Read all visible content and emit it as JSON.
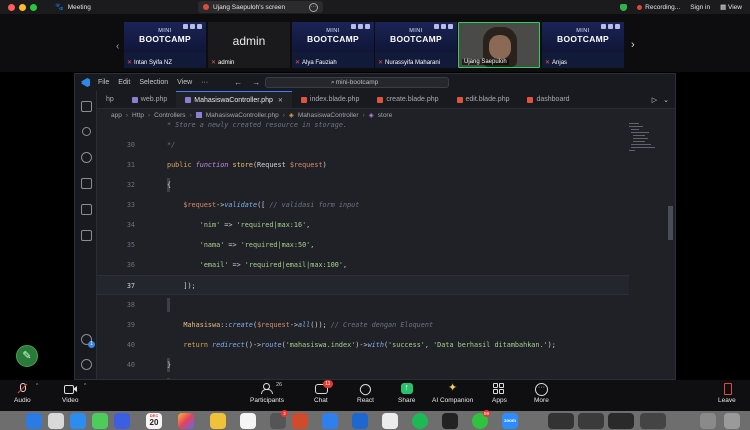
{
  "zoom": {
    "app_name": "Meeting",
    "share_title": "Ujang Saepuloh's screen",
    "recording_label": "Recording...",
    "signin_label": "Sign in",
    "view_label": "View"
  },
  "participants": [
    {
      "name": "Intan Syifa NZ",
      "kind": "banner",
      "line1": "MINI",
      "line2": "BOOTCAMP"
    },
    {
      "name": "admin",
      "kind": "admin",
      "display": "admin"
    },
    {
      "name": "Alya Fauziah",
      "kind": "banner",
      "line1": "MINI",
      "line2": "BOOTCAMP"
    },
    {
      "name": "Nurassyifa Maharani",
      "kind": "banner",
      "line1": "MINI",
      "line2": "BOOTCAMP"
    },
    {
      "name": "Ujang Saepuloh",
      "kind": "camera"
    },
    {
      "name": "Anjas",
      "kind": "banner",
      "line1": "MINI",
      "line2": "BOOTCAMP"
    }
  ],
  "vscode": {
    "menu": [
      "File",
      "Edit",
      "Selection",
      "View",
      "···"
    ],
    "command_center": "mini-bootcamp",
    "tabs": [
      {
        "label": "hp",
        "icon": "php",
        "active": false
      },
      {
        "label": "web.php",
        "icon": "php",
        "active": false
      },
      {
        "label": "MahasiswaController.php",
        "icon": "php",
        "active": true
      },
      {
        "label": "index.blade.php",
        "icon": "blade",
        "active": false
      },
      {
        "label": "create.blade.php",
        "icon": "blade",
        "active": false
      },
      {
        "label": "edit.blade.php",
        "icon": "blade",
        "active": false
      },
      {
        "label": "dashboard",
        "icon": "blade",
        "active": false
      }
    ],
    "breadcrumb": [
      "app",
      "Http",
      "Controllers",
      "MahasiswaController.php",
      "MahasiswaController",
      "store"
    ],
    "activity_badge": "1"
  },
  "code_lines": [
    {
      "n": "",
      "segs": [
        [
          "c-com",
          "* Store a newly created resource in storage."
        ]
      ]
    },
    {
      "n": "30",
      "segs": [
        [
          "c-com",
          "*/"
        ]
      ]
    },
    {
      "n": "31",
      "segs": [
        [
          "c-kw",
          "public "
        ],
        [
          "c-kw2",
          "function "
        ],
        [
          "c-fn",
          "store"
        ],
        [
          "c-txt",
          "(Request "
        ],
        [
          "c-var",
          "$request"
        ],
        [
          "c-txt",
          ")"
        ]
      ]
    },
    {
      "n": "32",
      "segs": [
        [
          "c-txt",
          "{"
        ]
      ]
    },
    {
      "n": "33",
      "segs": [
        [
          "c-txt",
          "    "
        ],
        [
          "c-var",
          "$request"
        ],
        [
          "c-txt",
          "->"
        ],
        [
          "c-mth",
          "validate"
        ],
        [
          "c-txt",
          "([ "
        ],
        [
          "c-com",
          "// validasi form input"
        ]
      ]
    },
    {
      "n": "34",
      "segs": [
        [
          "c-txt",
          "        "
        ],
        [
          "c-str",
          "'nim'"
        ],
        [
          "c-txt",
          " => "
        ],
        [
          "c-str",
          "'required|max:16'"
        ],
        [
          "c-txt",
          ","
        ]
      ]
    },
    {
      "n": "35",
      "segs": [
        [
          "c-txt",
          "        "
        ],
        [
          "c-str",
          "'nama'"
        ],
        [
          "c-txt",
          " => "
        ],
        [
          "c-str",
          "'required|max:50'"
        ],
        [
          "c-txt",
          ","
        ]
      ]
    },
    {
      "n": "36",
      "segs": [
        [
          "c-txt",
          "        "
        ],
        [
          "c-str",
          "'email'"
        ],
        [
          "c-txt",
          " => "
        ],
        [
          "c-str",
          "'required|email|max:100'"
        ],
        [
          "c-txt",
          ","
        ]
      ]
    },
    {
      "n": "37",
      "segs": [
        [
          "c-txt",
          "    ]);"
        ]
      ],
      "current": true
    },
    {
      "n": "38",
      "segs": []
    },
    {
      "n": "39",
      "segs": [
        [
          "c-txt",
          "    "
        ],
        [
          "c-cls",
          "Mahasiswa"
        ],
        [
          "c-txt",
          "::"
        ],
        [
          "c-mth",
          "create"
        ],
        [
          "c-txt",
          "("
        ],
        [
          "c-var",
          "$request"
        ],
        [
          "c-txt",
          "->"
        ],
        [
          "c-mth",
          "all"
        ],
        [
          "c-txt",
          "()); "
        ],
        [
          "c-com",
          "// Create dengan Eloquent"
        ]
      ]
    },
    {
      "n": "40",
      "segs": [
        [
          "c-txt",
          "    "
        ],
        [
          "c-kw",
          "return "
        ],
        [
          "c-mth",
          "redirect"
        ],
        [
          "c-txt",
          "()->"
        ],
        [
          "c-mth",
          "route"
        ],
        [
          "c-txt",
          "("
        ],
        [
          "c-str",
          "'mahasiswa.index'"
        ],
        [
          "c-txt",
          ")->"
        ],
        [
          "c-mth",
          "with"
        ],
        [
          "c-txt",
          "("
        ],
        [
          "c-str",
          "'success'"
        ],
        [
          "c-txt",
          ", "
        ],
        [
          "c-str",
          "'Data berhasil ditambahkan.'"
        ],
        [
          "c-txt",
          ");"
        ]
      ]
    },
    {
      "n": "40",
      "segs": [
        [
          "c-txt",
          "}"
        ]
      ]
    },
    {
      "n": "41",
      "segs": []
    }
  ],
  "toolbar": {
    "audio": "Audio",
    "video": "Video",
    "participants": "Participants",
    "participants_count": "26",
    "chat": "Chat",
    "chat_badge": "11",
    "react": "React",
    "share": "Share",
    "ai": "AI Companion",
    "apps": "Apps",
    "more": "More",
    "leave": "Leave"
  },
  "dock": {
    "calendar_month": "DEC",
    "calendar_day": "20",
    "badge_a": "2",
    "badge_b": "59"
  }
}
